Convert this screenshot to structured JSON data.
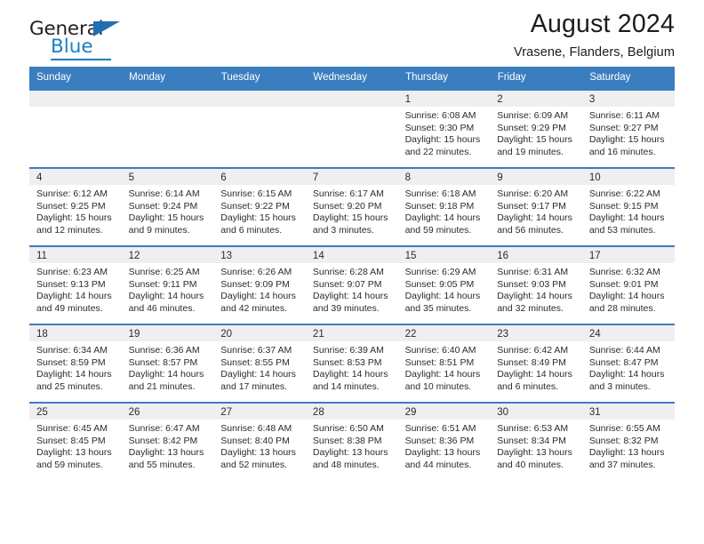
{
  "logo": {
    "line1": "General",
    "line2": "Blue",
    "triangle_color": "#1f6fb2",
    "blue_color": "#1a7fc1"
  },
  "header": {
    "title": "August 2024",
    "subtitle": "Vrasene, Flanders, Belgium"
  },
  "theme": {
    "header_blue": "#3b7ec0",
    "band_gray": "#efefef",
    "text": "#2b2b2b"
  },
  "weekdays": [
    "Sunday",
    "Monday",
    "Tuesday",
    "Wednesday",
    "Thursday",
    "Friday",
    "Saturday"
  ],
  "weeks": [
    [
      {
        "day": "",
        "sunrise": "",
        "sunset": "",
        "daylight": ""
      },
      {
        "day": "",
        "sunrise": "",
        "sunset": "",
        "daylight": ""
      },
      {
        "day": "",
        "sunrise": "",
        "sunset": "",
        "daylight": ""
      },
      {
        "day": "",
        "sunrise": "",
        "sunset": "",
        "daylight": ""
      },
      {
        "day": "1",
        "sunrise": "Sunrise: 6:08 AM",
        "sunset": "Sunset: 9:30 PM",
        "daylight": "Daylight: 15 hours and 22 minutes."
      },
      {
        "day": "2",
        "sunrise": "Sunrise: 6:09 AM",
        "sunset": "Sunset: 9:29 PM",
        "daylight": "Daylight: 15 hours and 19 minutes."
      },
      {
        "day": "3",
        "sunrise": "Sunrise: 6:11 AM",
        "sunset": "Sunset: 9:27 PM",
        "daylight": "Daylight: 15 hours and 16 minutes."
      }
    ],
    [
      {
        "day": "4",
        "sunrise": "Sunrise: 6:12 AM",
        "sunset": "Sunset: 9:25 PM",
        "daylight": "Daylight: 15 hours and 12 minutes."
      },
      {
        "day": "5",
        "sunrise": "Sunrise: 6:14 AM",
        "sunset": "Sunset: 9:24 PM",
        "daylight": "Daylight: 15 hours and 9 minutes."
      },
      {
        "day": "6",
        "sunrise": "Sunrise: 6:15 AM",
        "sunset": "Sunset: 9:22 PM",
        "daylight": "Daylight: 15 hours and 6 minutes."
      },
      {
        "day": "7",
        "sunrise": "Sunrise: 6:17 AM",
        "sunset": "Sunset: 9:20 PM",
        "daylight": "Daylight: 15 hours and 3 minutes."
      },
      {
        "day": "8",
        "sunrise": "Sunrise: 6:18 AM",
        "sunset": "Sunset: 9:18 PM",
        "daylight": "Daylight: 14 hours and 59 minutes."
      },
      {
        "day": "9",
        "sunrise": "Sunrise: 6:20 AM",
        "sunset": "Sunset: 9:17 PM",
        "daylight": "Daylight: 14 hours and 56 minutes."
      },
      {
        "day": "10",
        "sunrise": "Sunrise: 6:22 AM",
        "sunset": "Sunset: 9:15 PM",
        "daylight": "Daylight: 14 hours and 53 minutes."
      }
    ],
    [
      {
        "day": "11",
        "sunrise": "Sunrise: 6:23 AM",
        "sunset": "Sunset: 9:13 PM",
        "daylight": "Daylight: 14 hours and 49 minutes."
      },
      {
        "day": "12",
        "sunrise": "Sunrise: 6:25 AM",
        "sunset": "Sunset: 9:11 PM",
        "daylight": "Daylight: 14 hours and 46 minutes."
      },
      {
        "day": "13",
        "sunrise": "Sunrise: 6:26 AM",
        "sunset": "Sunset: 9:09 PM",
        "daylight": "Daylight: 14 hours and 42 minutes."
      },
      {
        "day": "14",
        "sunrise": "Sunrise: 6:28 AM",
        "sunset": "Sunset: 9:07 PM",
        "daylight": "Daylight: 14 hours and 39 minutes."
      },
      {
        "day": "15",
        "sunrise": "Sunrise: 6:29 AM",
        "sunset": "Sunset: 9:05 PM",
        "daylight": "Daylight: 14 hours and 35 minutes."
      },
      {
        "day": "16",
        "sunrise": "Sunrise: 6:31 AM",
        "sunset": "Sunset: 9:03 PM",
        "daylight": "Daylight: 14 hours and 32 minutes."
      },
      {
        "day": "17",
        "sunrise": "Sunrise: 6:32 AM",
        "sunset": "Sunset: 9:01 PM",
        "daylight": "Daylight: 14 hours and 28 minutes."
      }
    ],
    [
      {
        "day": "18",
        "sunrise": "Sunrise: 6:34 AM",
        "sunset": "Sunset: 8:59 PM",
        "daylight": "Daylight: 14 hours and 25 minutes."
      },
      {
        "day": "19",
        "sunrise": "Sunrise: 6:36 AM",
        "sunset": "Sunset: 8:57 PM",
        "daylight": "Daylight: 14 hours and 21 minutes."
      },
      {
        "day": "20",
        "sunrise": "Sunrise: 6:37 AM",
        "sunset": "Sunset: 8:55 PM",
        "daylight": "Daylight: 14 hours and 17 minutes."
      },
      {
        "day": "21",
        "sunrise": "Sunrise: 6:39 AM",
        "sunset": "Sunset: 8:53 PM",
        "daylight": "Daylight: 14 hours and 14 minutes."
      },
      {
        "day": "22",
        "sunrise": "Sunrise: 6:40 AM",
        "sunset": "Sunset: 8:51 PM",
        "daylight": "Daylight: 14 hours and 10 minutes."
      },
      {
        "day": "23",
        "sunrise": "Sunrise: 6:42 AM",
        "sunset": "Sunset: 8:49 PM",
        "daylight": "Daylight: 14 hours and 6 minutes."
      },
      {
        "day": "24",
        "sunrise": "Sunrise: 6:44 AM",
        "sunset": "Sunset: 8:47 PM",
        "daylight": "Daylight: 14 hours and 3 minutes."
      }
    ],
    [
      {
        "day": "25",
        "sunrise": "Sunrise: 6:45 AM",
        "sunset": "Sunset: 8:45 PM",
        "daylight": "Daylight: 13 hours and 59 minutes."
      },
      {
        "day": "26",
        "sunrise": "Sunrise: 6:47 AM",
        "sunset": "Sunset: 8:42 PM",
        "daylight": "Daylight: 13 hours and 55 minutes."
      },
      {
        "day": "27",
        "sunrise": "Sunrise: 6:48 AM",
        "sunset": "Sunset: 8:40 PM",
        "daylight": "Daylight: 13 hours and 52 minutes."
      },
      {
        "day": "28",
        "sunrise": "Sunrise: 6:50 AM",
        "sunset": "Sunset: 8:38 PM",
        "daylight": "Daylight: 13 hours and 48 minutes."
      },
      {
        "day": "29",
        "sunrise": "Sunrise: 6:51 AM",
        "sunset": "Sunset: 8:36 PM",
        "daylight": "Daylight: 13 hours and 44 minutes."
      },
      {
        "day": "30",
        "sunrise": "Sunrise: 6:53 AM",
        "sunset": "Sunset: 8:34 PM",
        "daylight": "Daylight: 13 hours and 40 minutes."
      },
      {
        "day": "31",
        "sunrise": "Sunrise: 6:55 AM",
        "sunset": "Sunset: 8:32 PM",
        "daylight": "Daylight: 13 hours and 37 minutes."
      }
    ]
  ]
}
